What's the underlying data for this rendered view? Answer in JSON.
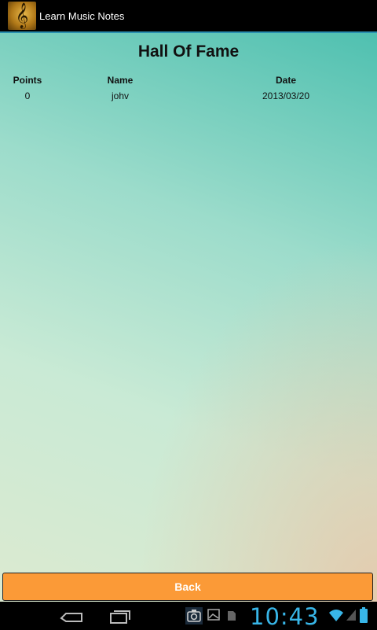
{
  "app": {
    "title": "Learn Music Notes",
    "icon": "treble-clef-icon"
  },
  "page": {
    "heading": "Hall Of Fame"
  },
  "table": {
    "columns": [
      "Points",
      "Name",
      "Date"
    ],
    "rows": [
      {
        "points": "0",
        "name": "johv",
        "date": "2013/03/20"
      }
    ]
  },
  "actions": {
    "back_label": "Back"
  },
  "status": {
    "time": "10:43"
  },
  "colors": {
    "accent": "#2a8fb0",
    "button": "#fb9a37",
    "clock": "#38b6e8"
  }
}
